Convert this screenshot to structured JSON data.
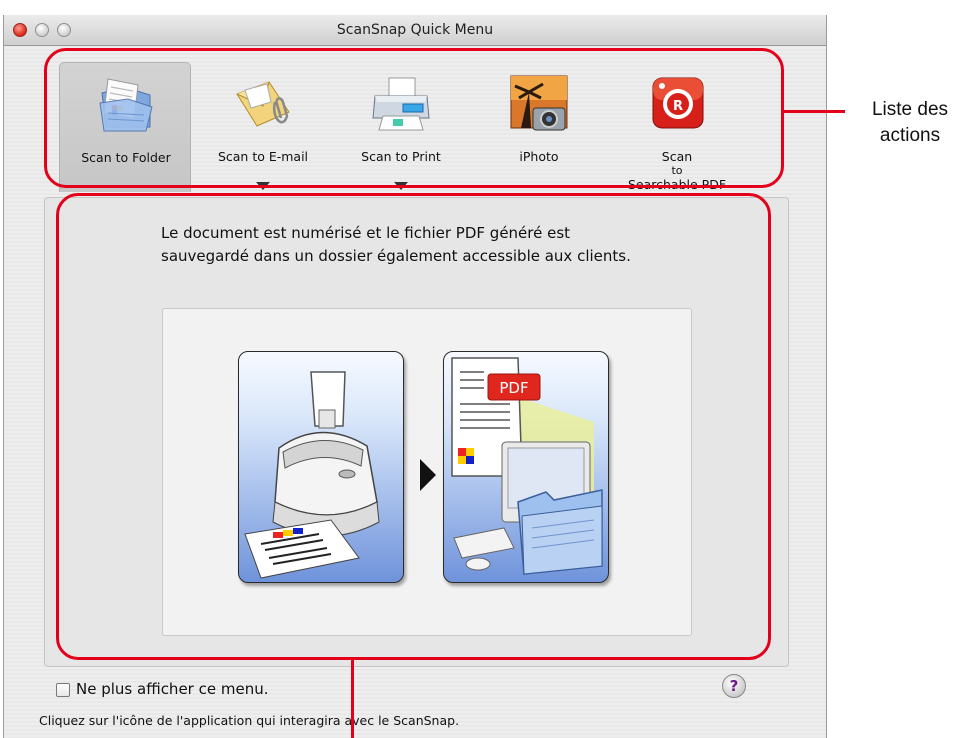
{
  "window": {
    "title": "ScanSnap Quick Menu"
  },
  "actions": [
    {
      "label": "Scan to Folder",
      "icon": "folder-scan-icon",
      "selected": true,
      "has_dropdown": false
    },
    {
      "label": "Scan to E-mail",
      "icon": "envelope-paperclip-icon",
      "selected": false,
      "has_dropdown": true
    },
    {
      "label": "Scan to Print",
      "icon": "printer-icon",
      "selected": false,
      "has_dropdown": true
    },
    {
      "label": "iPhoto",
      "icon": "iphoto-camera-icon",
      "selected": false,
      "has_dropdown": false
    },
    {
      "label_lines": [
        "Scan",
        "to",
        "Searchable PDF"
      ],
      "icon": "finereader-icon",
      "selected": false,
      "has_dropdown": false
    }
  ],
  "description": {
    "line1": "Le document est numérisé et le fichier PDF généré est",
    "line2": "sauvegardé dans un dossier également accessible aux clients."
  },
  "illustration": {
    "pdf_badge": "PDF"
  },
  "footer": {
    "checkbox_label": "Ne plus afficher ce menu.",
    "checkbox_checked": false,
    "hint_text": "Cliquez sur l'icône de l'application qui interagira avec le ScanSnap.",
    "help_label": "?"
  },
  "annotations": {
    "callout_line1": "Liste des",
    "callout_line2": "actions",
    "highlight_color": "#e4001b"
  }
}
